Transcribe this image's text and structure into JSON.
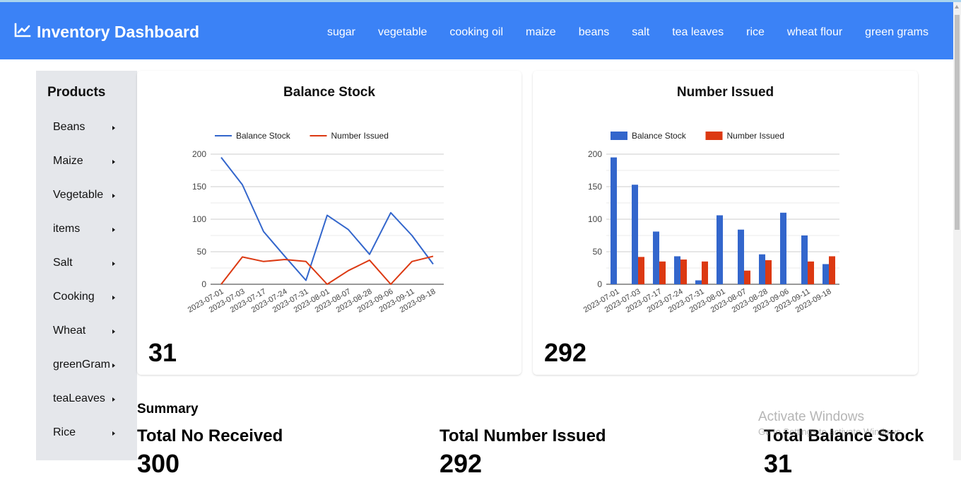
{
  "header": {
    "title": "Inventory Dashboard",
    "brand_icon": "chart-line-icon",
    "nav": [
      "sugar",
      "vegetable",
      "cooking oil",
      "maize",
      "beans",
      "salt",
      "tea leaves",
      "rice",
      "wheat flour",
      "green grams"
    ]
  },
  "sidebar": {
    "title": "Products",
    "items": [
      {
        "label": "Beans"
      },
      {
        "label": "Maize"
      },
      {
        "label": "Vegetable"
      },
      {
        "label": "items"
      },
      {
        "label": "Salt"
      },
      {
        "label": "Cooking"
      },
      {
        "label": "Wheat"
      },
      {
        "label": "greenGram"
      },
      {
        "label": "teaLeaves"
      },
      {
        "label": "Rice"
      }
    ]
  },
  "cards": {
    "balance": {
      "title": "Balance Stock",
      "value": "31"
    },
    "issued": {
      "title": "Number Issued",
      "value": "292"
    }
  },
  "chart_data": [
    {
      "type": "line",
      "categories": [
        "2023-07-01",
        "2023-07-03",
        "2023-07-17",
        "2023-07-24",
        "2023-07-31",
        "2023-08-01",
        "2023-08-07",
        "2023-08-28",
        "2023-09-06",
        "2023-09-11",
        "2023-09-18"
      ],
      "series": [
        {
          "name": "Balance Stock",
          "color": "#3366cc",
          "values": [
            195,
            153,
            81,
            43,
            6,
            106,
            84,
            46,
            110,
            75,
            31
          ]
        },
        {
          "name": "Number Issued",
          "color": "#dc3912",
          "values": [
            0,
            42,
            35,
            38,
            35,
            0,
            21,
            37,
            0,
            35,
            43
          ]
        }
      ],
      "yticks": [
        0,
        50,
        100,
        150,
        200
      ],
      "ylim": [
        0,
        200
      ],
      "legend": "top"
    },
    {
      "type": "bar",
      "categories": [
        "2023-07-01",
        "2023-07-03",
        "2023-07-17",
        "2023-07-24",
        "2023-07-31",
        "2023-08-01",
        "2023-08-07",
        "2023-08-28",
        "2023-09-06",
        "2023-09-11",
        "2023-09-18"
      ],
      "series": [
        {
          "name": "Balance Stock",
          "color": "#3366cc",
          "values": [
            195,
            153,
            81,
            43,
            6,
            106,
            84,
            46,
            110,
            75,
            31
          ]
        },
        {
          "name": "Number Issued",
          "color": "#dc3912",
          "values": [
            0,
            42,
            35,
            38,
            35,
            0,
            21,
            37,
            0,
            35,
            43
          ]
        }
      ],
      "yticks": [
        0,
        50,
        100,
        150,
        200
      ],
      "ylim": [
        0,
        200
      ],
      "legend": "top"
    }
  ],
  "summary": {
    "title": "Summary",
    "received_label": "Total No Received",
    "received_value": "300",
    "issued_label": "Total Number Issued",
    "issued_value": "292",
    "balance_label": "Total Balance Stock",
    "balance_value": "31"
  },
  "watermark": {
    "line1": "Activate Windows",
    "line2": "Go to Settings to activate Windows."
  }
}
